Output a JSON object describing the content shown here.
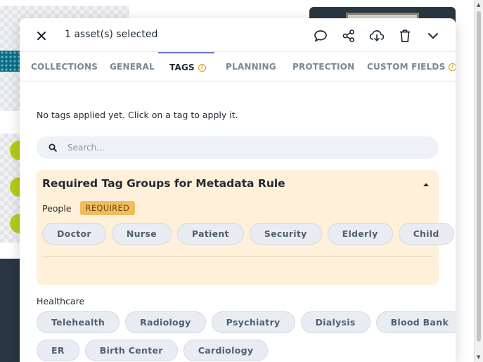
{
  "panel": {
    "selection_title": "1 asset(s) selected",
    "header_icons": [
      "comment-icon",
      "share-icon",
      "download-icon",
      "trash-icon",
      "chevron-down-icon"
    ]
  },
  "tabs": [
    {
      "label": "COLLECTIONS",
      "active": false,
      "info": false
    },
    {
      "label": "GENERAL",
      "active": false,
      "info": false
    },
    {
      "label": "TAGS",
      "active": true,
      "info": true
    },
    {
      "label": "PLANNING",
      "active": false,
      "info": false
    },
    {
      "label": "PROTECTION",
      "active": false,
      "info": false
    },
    {
      "label": "CUSTOM FIELDS",
      "active": false,
      "info": true
    }
  ],
  "info_glyph": "!",
  "tags_panel": {
    "empty_message": "No tags applied yet. Click on a tag to apply it.",
    "search_placeholder": "Search...",
    "required_section": {
      "title": "Required Tag Groups for Metadata Rule",
      "group_label": "People",
      "badge": "REQUIRED",
      "tags": [
        "Doctor",
        "Nurse",
        "Patient",
        "Security",
        "Elderly",
        "Child"
      ]
    },
    "healthcare": {
      "label": "Healthcare",
      "tags_row1": [
        "Telehealth",
        "Radiology",
        "Psychiatry",
        "Dialysis",
        "Blood Bank"
      ],
      "tags_row2": [
        "ER",
        "Birth Center",
        "Cardiology"
      ]
    }
  },
  "colors": {
    "accent_tab": "#6e79c9",
    "required_bg": "#fff0d9",
    "badge_bg": "#f0bc5e",
    "tag_bg": "#e9edf3",
    "bg_dot": "#b8cc19"
  }
}
